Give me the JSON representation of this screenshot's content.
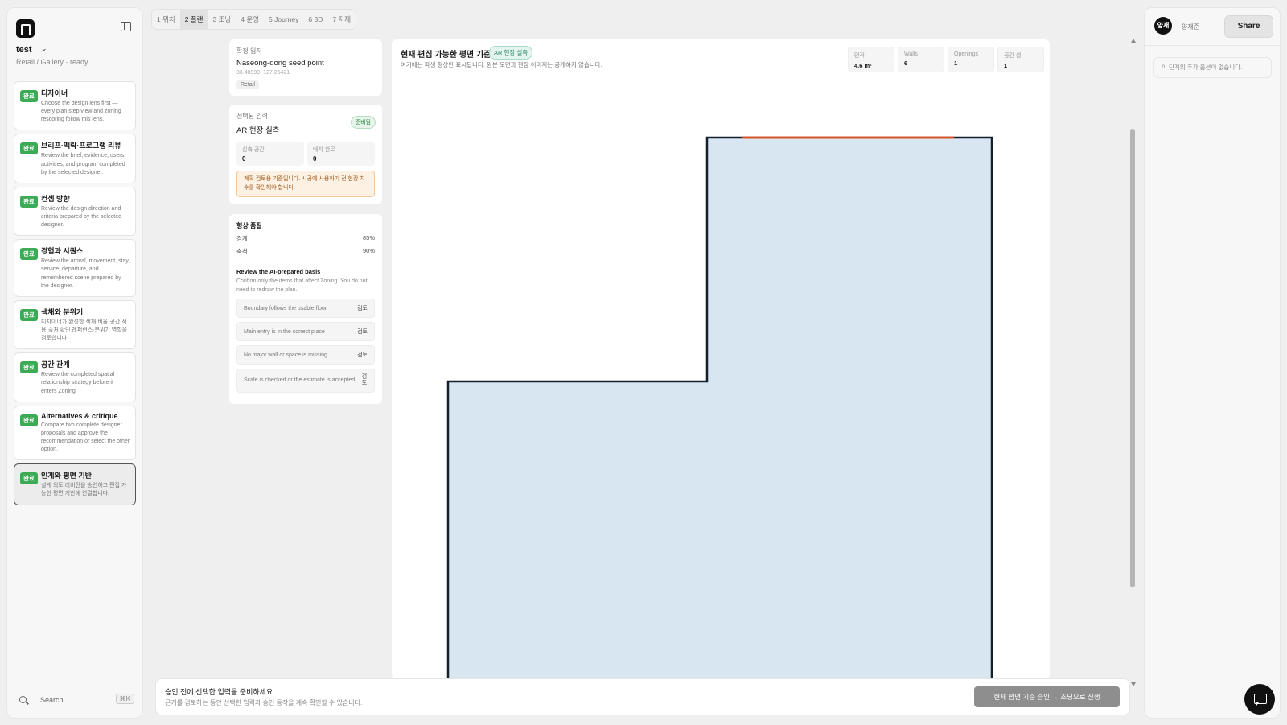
{
  "sidebar": {
    "project_name": "test",
    "project_sub": "Retail / Gallery · ready",
    "steps": [
      {
        "badge": "완료",
        "title": "디자이너",
        "desc": "Choose the design lens first — every plan step view and zoning rescoring follow this lens."
      },
      {
        "badge": "완료",
        "title": "브리프·맥락·프로그램 리뷰",
        "desc": "Review the brief, evidence, users, activities, and program completed by the selected designer."
      },
      {
        "badge": "완료",
        "title": "컨셉 방향",
        "desc": "Review the design direction and criteria prepared by the selected designer."
      },
      {
        "badge": "완료",
        "title": "경험과 시퀀스",
        "desc": "Review the arrival, movement, stay, service, departure, and remembered scene prepared by the designer."
      },
      {
        "badge": "완료",
        "title": "색채와 분위기",
        "desc": "디자이너가 완성한 색채 비율·공간 적용·출처 확인 레퍼런스·분위기 역할을 검토합니다."
      },
      {
        "badge": "완료",
        "title": "공간 관계",
        "desc": "Review the completed spatial relationship strategy before it enters Zoning."
      },
      {
        "badge": "완료",
        "title": "Alternatives & critique",
        "desc": "Compare two complete designer proposals and approve the recommendation or select the other option."
      },
      {
        "badge": "완료",
        "title": "인계와 평면 기반",
        "desc": "설계 의도 리비전을 승인하고 편집 가능한 평면 기반에 연결합니다."
      }
    ],
    "search_label": "Search",
    "search_shortcut": "⌘K"
  },
  "tabs": [
    {
      "num": "1",
      "label": "위치"
    },
    {
      "num": "2",
      "label": "플랜"
    },
    {
      "num": "3",
      "label": "조닝"
    },
    {
      "num": "4",
      "label": "운영"
    },
    {
      "num": "5",
      "label": "Journey"
    },
    {
      "num": "6",
      "label": "3D"
    },
    {
      "num": "7",
      "label": "자재"
    }
  ],
  "site": {
    "label": "확정 입지",
    "name": "Naseong-dong seed point",
    "coords": "36.48999, 127.26421",
    "tag": "Retail"
  },
  "input": {
    "label": "선택된 입력",
    "name": "AR 현장 실측",
    "status": "준비됨",
    "stat1_label": "실측 공간",
    "stat1_value": "0",
    "stat2_label": "배치 완료",
    "stat2_value": "0",
    "warning": "계획 검토용 기준입니다. 시공에 사용하기 전 현장 치수를 확인해야 합니다."
  },
  "quality": {
    "title": "형상 품질",
    "row1_label": "경계",
    "row1_value": "85%",
    "row2_label": "축척",
    "row2_value": "90%",
    "review_title": "Review the AI-prepared basis",
    "review_desc": "Confirm only the items that affect Zoning. You do not need to redraw the plan.",
    "checks": [
      {
        "label": "Boundary follows the usable floor",
        "action": "검토"
      },
      {
        "label": "Main entry is in the correct place",
        "action": "검토"
      },
      {
        "label": "No major wall or space is missing",
        "action": "검토"
      },
      {
        "label": "Scale is checked or the estimate is accepted",
        "action": "검토"
      }
    ]
  },
  "plan": {
    "title": "현재 편집 가능한 평면 기준",
    "badge": "AR 현장 실측",
    "subtitle": "여기에는 파생 형상만 표시됩니다. 원본 도면과 현장 이미지는 공개하지 않습니다.",
    "stats": [
      {
        "label": "면적",
        "value": "4.6 m²"
      },
      {
        "label": "Walls",
        "value": "6"
      },
      {
        "label": "Openings",
        "value": "1"
      },
      {
        "label": "공간 셀",
        "value": "1"
      }
    ],
    "fill_color": "#d8e6f1",
    "wall_color": "#15202e",
    "opening_color": "#d4552a"
  },
  "bottom": {
    "title": "승인 전에 선택한 입력을 준비하세요",
    "subtitle": "근거를 검토하는 동안 선택한 입력과 승인 동작을 계속 확인할 수 있습니다.",
    "cta": "현재 평면 기준 승인 → 조닝으로 진행"
  },
  "right": {
    "avatar": "양재",
    "user_name": "양재준",
    "share": "Share",
    "no_options": "이 단계의 추가 옵션이 없습니다."
  }
}
